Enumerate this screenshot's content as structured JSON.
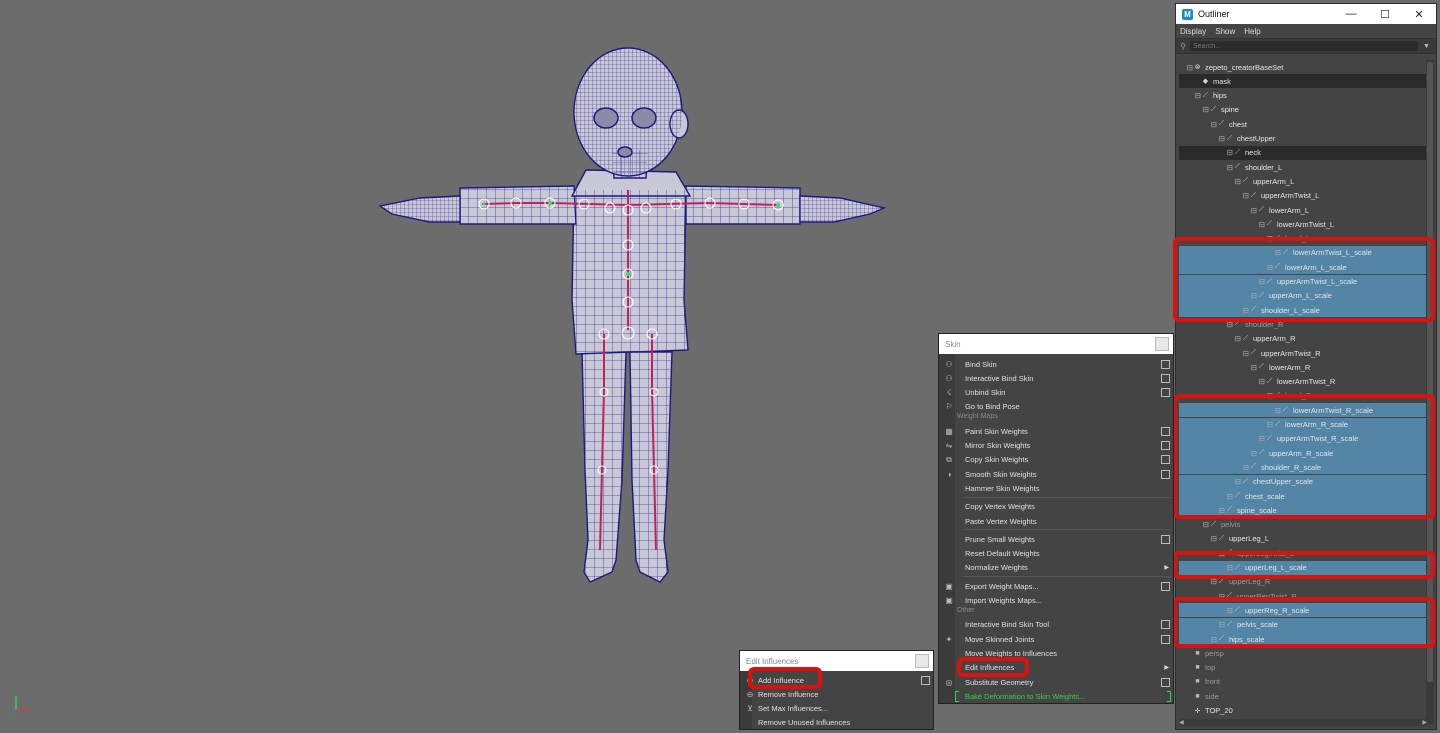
{
  "outliner": {
    "title": "Outliner",
    "window_buttons": [
      "—",
      "☐",
      "✕"
    ],
    "menu": [
      "Display",
      "Show",
      "Help"
    ],
    "search_placeholder": "Search...",
    "rows": [
      {
        "label": "zepeto_creatorBaseSet",
        "icon": "set-icon",
        "indent": 1,
        "state": "normal"
      },
      {
        "label": "mask",
        "icon": "mesh-icon",
        "indent": 2,
        "state": "blk"
      },
      {
        "label": "hips",
        "icon": "joint-icon",
        "indent": 2,
        "state": "normal"
      },
      {
        "label": "spine",
        "icon": "joint-icon",
        "indent": 3,
        "state": "normal"
      },
      {
        "label": "chest",
        "icon": "joint-icon",
        "indent": 4,
        "state": "normal"
      },
      {
        "label": "chestUpper",
        "icon": "joint-icon",
        "indent": 5,
        "state": "normal"
      },
      {
        "label": "neck",
        "icon": "joint-icon",
        "indent": 6,
        "state": "blk"
      },
      {
        "label": "shoulder_L",
        "icon": "joint-icon",
        "indent": 6,
        "state": "normal"
      },
      {
        "label": "upperArm_L",
        "icon": "joint-icon",
        "indent": 7,
        "state": "normal"
      },
      {
        "label": "upperArmTwist_L",
        "icon": "joint-icon",
        "indent": 8,
        "state": "normal"
      },
      {
        "label": "lowerArm_L",
        "icon": "joint-icon",
        "indent": 9,
        "state": "normal"
      },
      {
        "label": "lowerArmTwist_L",
        "icon": "joint-icon",
        "indent": 10,
        "state": "normal"
      },
      {
        "label": "hand_L",
        "icon": "joint-icon",
        "indent": 11,
        "state": "dim"
      },
      {
        "label": "lowerArmTwist_L_scale",
        "icon": "joint-icon",
        "indent": 12,
        "state": "sel"
      },
      {
        "label": "lowerArm_L_scale",
        "icon": "joint-icon",
        "indent": 11,
        "state": "sel"
      },
      {
        "label": "upperArmTwist_L_scale",
        "icon": "joint-icon",
        "indent": 10,
        "state": "sel"
      },
      {
        "label": "upperArm_L_scale",
        "icon": "joint-icon",
        "indent": 9,
        "state": "sel"
      },
      {
        "label": "shoulder_L_scale",
        "icon": "joint-icon",
        "indent": 8,
        "state": "sel"
      },
      {
        "label": "shoulder_R",
        "icon": "joint-icon",
        "indent": 6,
        "state": "dim"
      },
      {
        "label": "upperArm_R",
        "icon": "joint-icon",
        "indent": 7,
        "state": "normal"
      },
      {
        "label": "upperArmTwist_R",
        "icon": "joint-icon",
        "indent": 8,
        "state": "normal"
      },
      {
        "label": "lowerArm_R",
        "icon": "joint-icon",
        "indent": 9,
        "state": "normal"
      },
      {
        "label": "lowerArmTwist_R",
        "icon": "joint-icon",
        "indent": 10,
        "state": "normal"
      },
      {
        "label": "hand_R",
        "icon": "joint-icon",
        "indent": 11,
        "state": "dim"
      },
      {
        "label": "lowerArmTwist_R_scale",
        "icon": "joint-icon",
        "indent": 12,
        "state": "sel"
      },
      {
        "label": "lowerArm_R_scale",
        "icon": "joint-icon",
        "indent": 11,
        "state": "sel"
      },
      {
        "label": "upperArmTwist_R_scale",
        "icon": "joint-icon",
        "indent": 10,
        "state": "sel"
      },
      {
        "label": "upperArm_R_scale",
        "icon": "joint-icon",
        "indent": 9,
        "state": "sel"
      },
      {
        "label": "shoulder_R_scale",
        "icon": "joint-icon",
        "indent": 8,
        "state": "sel"
      },
      {
        "label": "chestUpper_scale",
        "icon": "joint-icon",
        "indent": 7,
        "state": "sel"
      },
      {
        "label": "chest_scale",
        "icon": "joint-icon",
        "indent": 6,
        "state": "sel"
      },
      {
        "label": "spine_scale",
        "icon": "joint-icon",
        "indent": 5,
        "state": "sel"
      },
      {
        "label": "pelvis",
        "icon": "joint-icon",
        "indent": 3,
        "state": "dim"
      },
      {
        "label": "upperLeg_L",
        "icon": "joint-icon",
        "indent": 4,
        "state": "normal"
      },
      {
        "label": "upperLegTwist_L",
        "icon": "joint-icon",
        "indent": 5,
        "state": "dim"
      },
      {
        "label": "upperLeg_L_scale",
        "icon": "joint-icon",
        "indent": 6,
        "state": "sel"
      },
      {
        "label": "upperLeg_R",
        "icon": "joint-icon",
        "indent": 4,
        "state": "dim"
      },
      {
        "label": "upperRegTwist_R",
        "icon": "joint-icon",
        "indent": 5,
        "state": "dim"
      },
      {
        "label": "upperReg_R_scale",
        "icon": "joint-icon",
        "indent": 6,
        "state": "sel"
      },
      {
        "label": "pelvis_scale",
        "icon": "joint-icon",
        "indent": 5,
        "state": "sel"
      },
      {
        "label": "hips_scale",
        "icon": "joint-icon",
        "indent": 4,
        "state": "sel"
      },
      {
        "label": "persp",
        "icon": "camera-icon",
        "indent": 1,
        "state": "dim"
      },
      {
        "label": "top",
        "icon": "camera-icon",
        "indent": 1,
        "state": "dim"
      },
      {
        "label": "front",
        "icon": "camera-icon",
        "indent": 1,
        "state": "dim"
      },
      {
        "label": "side",
        "icon": "camera-icon",
        "indent": 1,
        "state": "dim"
      },
      {
        "label": "TOP_20",
        "icon": "locator-icon",
        "indent": 1,
        "state": "normal"
      }
    ]
  },
  "skin_menu": {
    "title": "Skin",
    "items": [
      {
        "label": "Bind Skin",
        "icon": "bind-skin-icon",
        "option": true
      },
      {
        "label": "Interactive Bind Skin",
        "icon": "interactive-bind-icon",
        "option": true
      },
      {
        "label": "Unbind Skin",
        "icon": "unbind-icon",
        "option": true
      },
      {
        "label": "Go to Bind Pose",
        "icon": "bind-pose-icon",
        "option": false
      },
      {
        "section": "Weight Maps"
      },
      {
        "label": "Paint Skin Weights",
        "icon": "paint-weights-icon",
        "option": true
      },
      {
        "label": "Mirror Skin Weights",
        "icon": "mirror-weights-icon",
        "option": true
      },
      {
        "label": "Copy Skin Weights",
        "icon": "copy-weights-icon",
        "option": true
      },
      {
        "label": "Smooth Skin Weights",
        "icon": "smooth-weights-icon",
        "option": true
      },
      {
        "label": "Hammer Skin Weights",
        "icon": "",
        "option": false
      },
      {
        "sep": true
      },
      {
        "label": "Copy Vertex Weights",
        "icon": "",
        "option": false
      },
      {
        "label": "Paste Vertex Weights",
        "icon": "",
        "option": false
      },
      {
        "sep": true
      },
      {
        "label": "Prune Small Weights",
        "icon": "",
        "option": true
      },
      {
        "label": "Reset Default Weights",
        "icon": "",
        "option": false
      },
      {
        "label": "Normalize Weights",
        "icon": "",
        "option": false,
        "arrow": true
      },
      {
        "sep": true
      },
      {
        "label": "Export Weight Maps...",
        "icon": "export-maps-icon",
        "option": true
      },
      {
        "label": "Import Weights Maps...",
        "icon": "import-maps-icon",
        "option": false
      },
      {
        "section": "Other"
      },
      {
        "label": "Interactive Bind Skin Tool",
        "icon": "",
        "option": true
      },
      {
        "label": "Move Skinned Joints",
        "icon": "move-joints-icon",
        "option": true
      },
      {
        "label": "Move Weights to Influences",
        "icon": "",
        "option": false
      },
      {
        "label": "Edit Influences",
        "icon": "",
        "option": false,
        "arrow": true
      },
      {
        "label": "Substitute Geometry",
        "icon": "substitute-icon",
        "option": true
      },
      {
        "label": "Bake Deformation to Skin Weights...",
        "icon": "",
        "option": false,
        "bake": true
      }
    ]
  },
  "edit_influences": {
    "title": "Edit Influences",
    "items": [
      {
        "label": "Add Influence",
        "icon": "add-influence-icon",
        "option": true
      },
      {
        "label": "Remove Influence",
        "icon": "remove-influence-icon",
        "option": false
      },
      {
        "label": "Set Max Influences...",
        "icon": "max-influence-icon",
        "option": false
      },
      {
        "label": "Remove Unused Influences",
        "icon": "",
        "option": false
      }
    ]
  },
  "colors": {
    "viewport": "#6c6c6c",
    "selection": "#5285a6",
    "highlight": "#dd0f0f",
    "wireframe": "#1c1a7a",
    "bake_text": "#36d04a"
  }
}
